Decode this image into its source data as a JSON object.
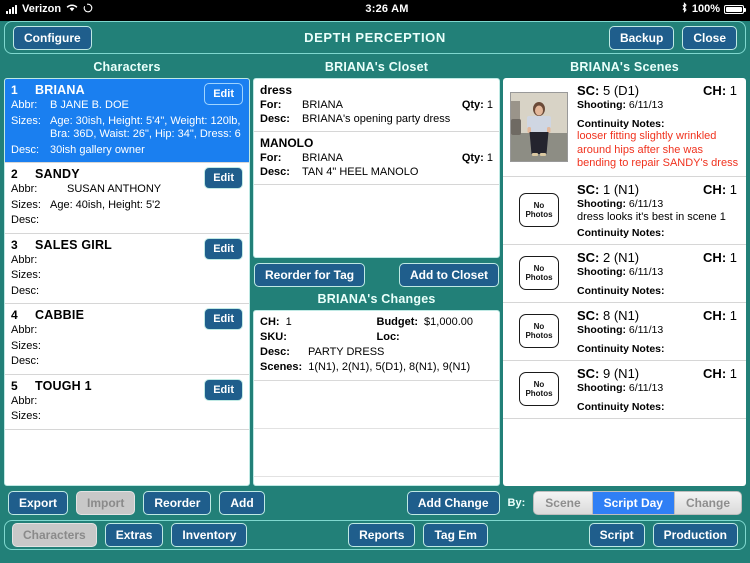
{
  "status_bar": {
    "carrier": "Verizon",
    "wifi_icon": "wifi-icon",
    "sync_icon": "sync-icon",
    "time": "3:26 AM",
    "bluetooth_icon": "bluetooth-icon",
    "battery_percent": "100%"
  },
  "topbar": {
    "configure_label": "Configure",
    "title": "DEPTH PERCEPTION",
    "backup_label": "Backup",
    "close_label": "Close"
  },
  "characters_panel": {
    "title": "Characters",
    "field_labels": {
      "abbr": "Abbr:",
      "sizes": "Sizes:",
      "desc": "Desc:"
    },
    "edit_label": "Edit",
    "rows": [
      {
        "num": "1",
        "name": "BRIANA",
        "selected": true,
        "abbr": "B  JANE B. DOE",
        "sizes": "Age: 30ish, Height: 5'4\", Weight: 120lb, Bra: 36D, Waist: 26\", Hip: 34\", Dress: 6",
        "desc": "30ish gallery owner"
      },
      {
        "num": "2",
        "name": "SANDY",
        "selected": false,
        "abbr": "SUSAN ANTHONY",
        "sizes": "Age: 40ish, Height: 5'2",
        "desc": ""
      },
      {
        "num": "3",
        "name": "SALES GIRL",
        "selected": false,
        "abbr": "",
        "sizes": "",
        "desc": ""
      },
      {
        "num": "4",
        "name": "CABBIE",
        "selected": false,
        "abbr": "",
        "sizes": "",
        "desc": ""
      },
      {
        "num": "5",
        "name": "TOUGH 1",
        "selected": false,
        "abbr": "",
        "sizes": "",
        "desc": ""
      }
    ]
  },
  "closet_panel": {
    "title": "BRIANA's Closet",
    "labels": {
      "for": "For:",
      "desc": "Desc:",
      "qty": "Qty:"
    },
    "items": [
      {
        "name": "dress",
        "for": "BRIANA",
        "qty": "1",
        "desc": "BRIANA's opening party dress"
      },
      {
        "name": "MANOLO",
        "for": "BRIANA",
        "qty": "1",
        "desc": "TAN 4\" HEEL MANOLO"
      }
    ],
    "reorder_label": "Reorder for Tag",
    "add_to_closet_label": "Add to Closet"
  },
  "changes_panel": {
    "title": "BRIANA's Changes",
    "labels": {
      "ch": "CH:",
      "budget": "Budget:",
      "sku": "SKU:",
      "loc": "Loc:",
      "desc": "Desc:",
      "scenes": "Scenes:"
    },
    "rows": [
      {
        "ch": "1",
        "budget": "$1,000.00",
        "sku": "",
        "loc": "",
        "desc": "PARTY DRESS",
        "scenes": "1(N1), 2(N1), 5(D1), 8(N1), 9(N1)"
      }
    ]
  },
  "scenes_panel": {
    "title": "BRIANA's Scenes",
    "labels": {
      "sc": "SC:",
      "ch": "CH:",
      "shooting": "Shooting:",
      "continuity": "Continuity Notes:"
    },
    "no_photos_line1": "No",
    "no_photos_line2": "Photos",
    "rows": [
      {
        "sc": "5 (D1)",
        "ch": "1",
        "shooting": "6/11/13",
        "has_photo": true,
        "note": "",
        "continuity": "looser fitting slightly wrinkled around hips after she was bending to repair SANDY's dress"
      },
      {
        "sc": "1 (N1)",
        "ch": "1",
        "shooting": "6/11/13",
        "has_photo": false,
        "note": "dress looks it's best in scene 1",
        "continuity": ""
      },
      {
        "sc": "2 (N1)",
        "ch": "1",
        "shooting": "6/11/13",
        "has_photo": false,
        "note": "",
        "continuity": ""
      },
      {
        "sc": "8 (N1)",
        "ch": "1",
        "shooting": "6/11/13",
        "has_photo": false,
        "note": "",
        "continuity": ""
      },
      {
        "sc": "9 (N1)",
        "ch": "1",
        "shooting": "6/11/13",
        "has_photo": false,
        "note": "",
        "continuity": ""
      }
    ]
  },
  "action_bar": {
    "export_label": "Export",
    "import_label": "Import",
    "reorder_label": "Reorder",
    "add_label": "Add",
    "add_change_label": "Add Change",
    "by_label": "By:",
    "segments": [
      {
        "label": "Scene",
        "selected": false
      },
      {
        "label": "Script Day",
        "selected": true
      },
      {
        "label": "Change",
        "selected": false
      }
    ]
  },
  "nav_bar": {
    "characters_label": "Characters",
    "extras_label": "Extras",
    "inventory_label": "Inventory",
    "reports_label": "Reports",
    "tag_em_label": "Tag Em",
    "script_label": "Script",
    "production_label": "Production"
  },
  "colors": {
    "teal": "#228078",
    "button_blue": "#1f5e8c",
    "selected_row_blue": "#1a7ff0",
    "segment_blue": "#2f7ff5",
    "continuity_red": "#f0321e"
  }
}
